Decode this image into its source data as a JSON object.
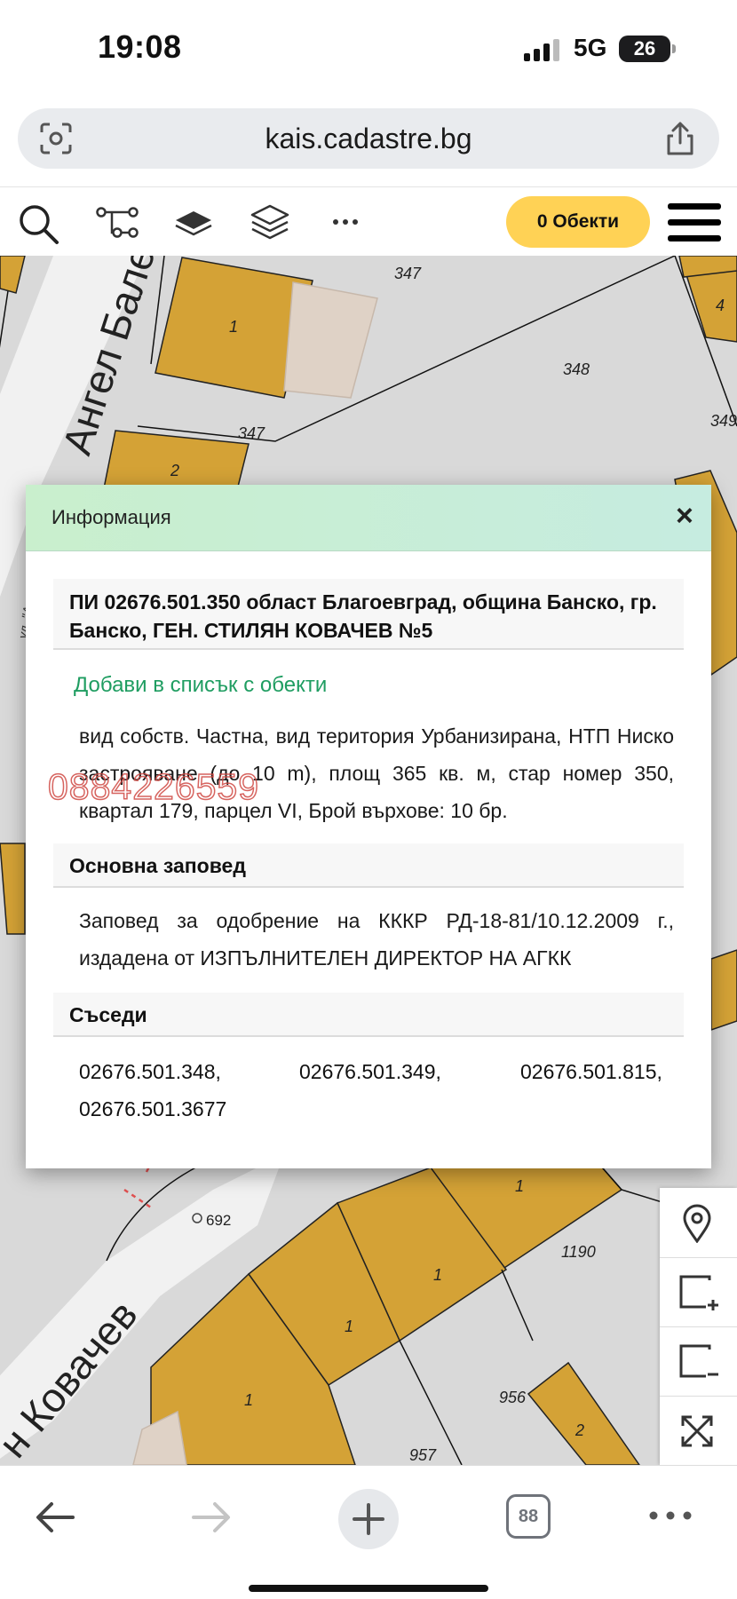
{
  "status_bar": {
    "time": "19:08",
    "network": "5G",
    "battery": "26"
  },
  "browser": {
    "url": "kais.cadastre.bg",
    "tabs_count": "88"
  },
  "toolbar": {
    "objects_button_label": "0 Обекти",
    "icons": [
      "search-icon",
      "route-icon",
      "layer-icon",
      "layers-icon",
      "more-icon",
      "menu-icon"
    ]
  },
  "map": {
    "labels": {
      "street_top": "Ангел Балев",
      "street_bottom": "н Ковачев",
      "street_side": "ул. \"Ан",
      "p347a": "347",
      "p347b": "347",
      "p348": "348",
      "p349": "349",
      "p4": "4",
      "b1_top": "1",
      "b2_top": "2",
      "point692": "692",
      "b1_r": "1",
      "p1190": "1190",
      "b1_c": "1",
      "b1_l": "1",
      "b1_bl": "1",
      "p956": "956",
      "b2_br": "2",
      "p957": "957"
    }
  },
  "dialog": {
    "title": "Информация",
    "close_label": "×",
    "parcel_title": "ПИ 02676.501.350 област Благоевград, община Банско, гр. Банско, ГЕН. СТИЛЯН КОВАЧЕВ №5",
    "add_to_list": "Добави в списък с обекти",
    "details": "вид собств. Частна, вид територия Урбанизирана, НТП Ниско застрояване (до 10 m), площ 365 кв. м, стар номер 350, квартал 179, парцел VI, Брой върхове: 10 бр.",
    "phone_overlay": "0884226559",
    "order_title": "Основна заповед",
    "order_text": "Заповед за одобрение на КККР РД-18-81/10.12.2009 г., издадена от ИЗПЪЛНИТЕЛЕН ДИРЕКТОР НА АГКК",
    "neighbors_title": "Съседи",
    "neighbors": [
      "02676.501.348,",
      "02676.501.349,",
      "02676.501.815,",
      "02676.501.3677"
    ]
  },
  "colors": {
    "building": "#d4a236",
    "parcel_bg": "#d9d9d9",
    "road": "#f1f1f1",
    "accent_yellow": "#ffd255",
    "link_green": "#1f9d61",
    "header_green": "#c9efcd"
  }
}
